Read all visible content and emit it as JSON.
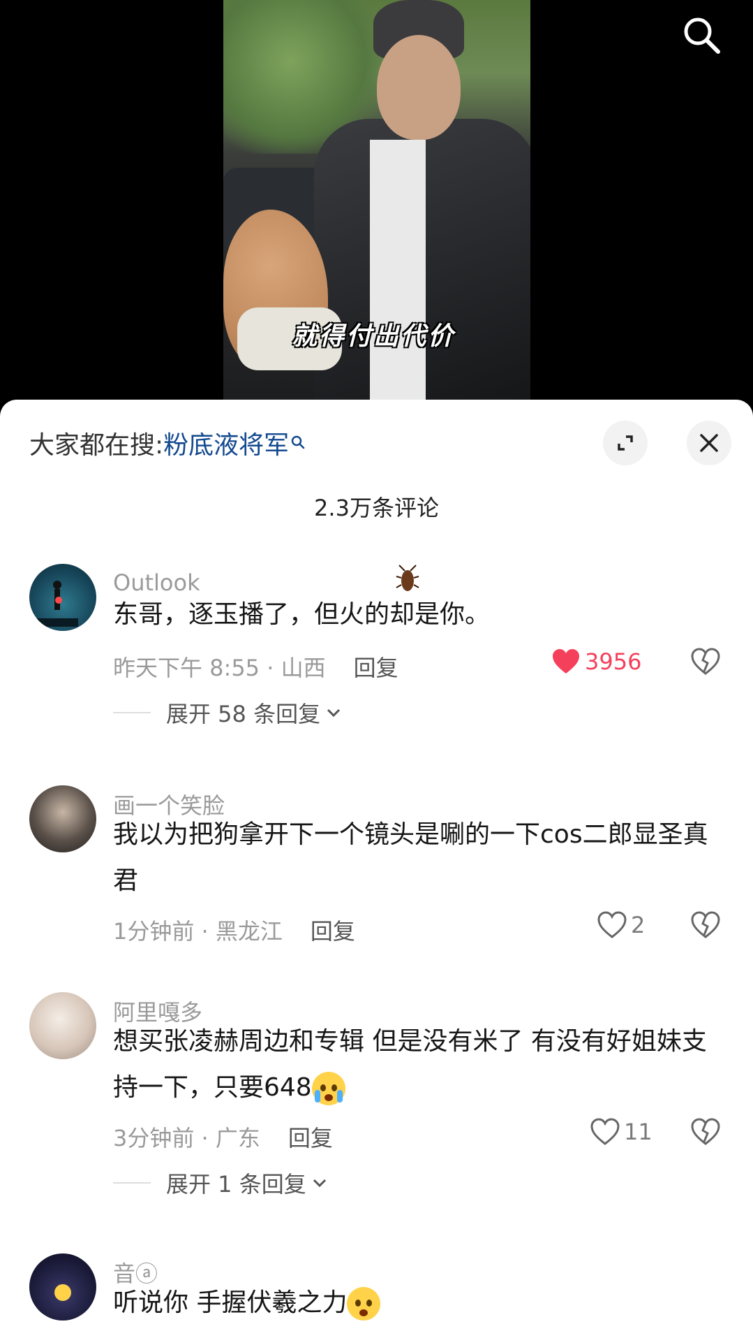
{
  "video": {
    "subtitle": "就得付出代价"
  },
  "sheet": {
    "trend_prefix": "大家都在搜:",
    "trend_keyword": "粉底液将军",
    "comment_count": "2.3万条评论"
  },
  "comments": [
    {
      "username": "Outlook",
      "text": "东哥，逐玉播了，但火的却是你。",
      "time": "昨天下午 8:55",
      "location": "山西",
      "reply": "回复",
      "likes": "3956",
      "liked": true,
      "expand": "展开 58 条回复"
    },
    {
      "username": "画一个笑脸",
      "text": "我以为把狗拿开下一个镜头是唰的一下cos二郎显圣真君",
      "time": "1分钟前",
      "location": "黑龙江",
      "reply": "回复",
      "likes": "2",
      "liked": false
    },
    {
      "username": "阿里嘎多",
      "text": "想买张凌赫周边和专辑 但是没有米了  有没有好姐妹支持一下，只要648",
      "time": "3分钟前",
      "location": "广东",
      "reply": "回复",
      "likes": "11",
      "liked": false,
      "expand": "展开 1 条回复"
    },
    {
      "username": "音ⓐ",
      "text": "听说你 手握伏羲之力"
    }
  ],
  "colors": {
    "like_active": "#f5405b",
    "keyword": "#13498f"
  }
}
